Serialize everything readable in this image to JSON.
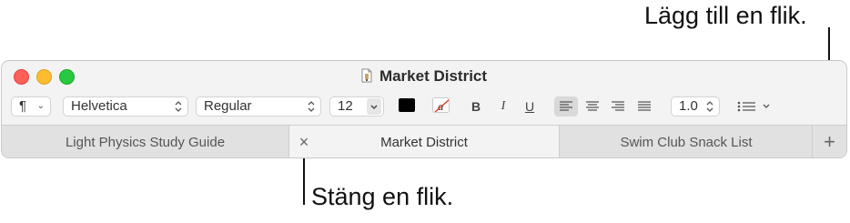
{
  "callouts": {
    "add_tab": "Lägg till en flik.",
    "close_tab": "Stäng en flik."
  },
  "window": {
    "title": "Market District",
    "title_icon": "text-document-icon"
  },
  "toolbar": {
    "paragraph_style_symbol": "¶",
    "font_family": "Helvetica",
    "typeface": "Regular",
    "font_size": "12",
    "text_color": "#000000",
    "bold": "B",
    "italic": "I",
    "underline": "U",
    "line_spacing": "1.0"
  },
  "tabs": [
    {
      "label": "Light Physics Study Guide",
      "active": false
    },
    {
      "label": "Market District",
      "active": true
    },
    {
      "label": "Swim Club Snack List",
      "active": false
    }
  ],
  "tabbar": {
    "close_symbol": "×",
    "add_symbol": "+"
  }
}
